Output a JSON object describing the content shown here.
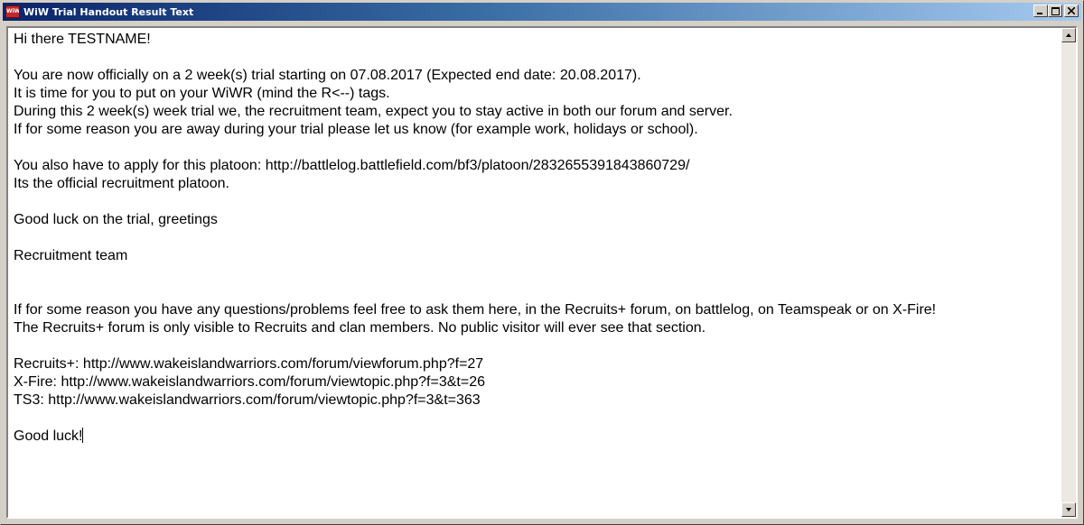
{
  "window": {
    "title": "WiW Trial Handout Result Text",
    "icon_text": "WiW"
  },
  "controls": {
    "minimize": "minimize-icon",
    "maximize": "maximize-icon",
    "close": "close-icon"
  },
  "content": {
    "lines": [
      "Hi there TESTNAME!",
      "",
      "You are now officially on a 2 week(s) trial starting on 07.08.2017 (Expected end date: 20.08.2017).",
      "It is time for you to put on your WiWR (mind the R<--) tags.",
      "During this 2 week(s) week trial we, the recruitment team, expect you to stay active in both our forum and server.",
      "If for some reason you are away during your trial please let us know (for example work, holidays or school).",
      "",
      "You also have to apply for this platoon: http://battlelog.battlefield.com/bf3/platoon/2832655391843860729/",
      "Its the official recruitment platoon.",
      "",
      "Good luck on the trial, greetings",
      "",
      "Recruitment team",
      "",
      "",
      "If for some reason you have any questions/problems feel free to ask them here, in the Recruits+ forum, on battlelog, on Teamspeak or on X-Fire!",
      "The Recruits+ forum is only visible to Recruits and clan members. No public visitor will ever see that section.",
      "",
      "Recruits+: http://www.wakeislandwarriors.com/forum/viewforum.php?f=27",
      "X-Fire: http://www.wakeislandwarriors.com/forum/viewtopic.php?f=3&t=26",
      "TS3: http://www.wakeislandwarriors.com/forum/viewtopic.php?f=3&t=363",
      "",
      "Good luck!"
    ]
  }
}
